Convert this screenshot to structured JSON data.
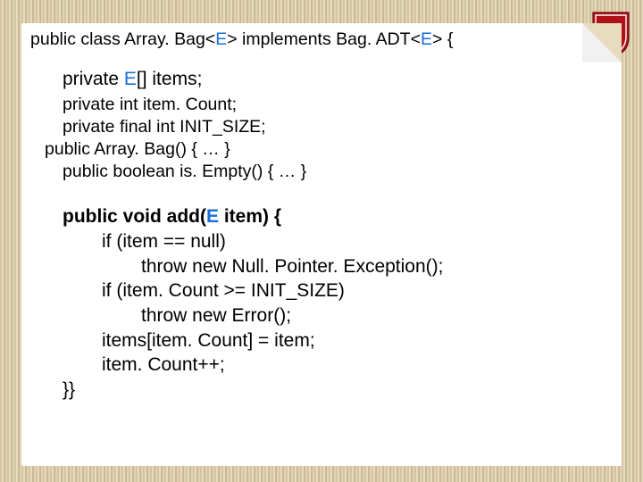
{
  "signature": {
    "p1": "public class Array. Bag<",
    "E1": "E",
    "p2": "> implements Bag. ADT<",
    "E2": "E",
    "p3": "> {"
  },
  "decl": {
    "priv1a": "private ",
    "priv1E": "E",
    "priv1b": "[] items;",
    "priv2": "private int item. Count;",
    "priv3": "private final int INIT_SIZE;",
    "ctor": "public Array. Bag() { … }",
    "isEmpty": "public boolean is. Empty() { … }"
  },
  "method": {
    "head1": "public void add(",
    "headE": "E",
    "head2": " item) {",
    "l1": "if (item == null)",
    "l2": "throw new Null. Pointer. Exception();",
    "l3": "if (item. Count >= INIT_SIZE)",
    "l4": "throw new Error();",
    "l5": "items[item. Count] = item;",
    "l6": "item. Count++;",
    "close": "}}"
  }
}
